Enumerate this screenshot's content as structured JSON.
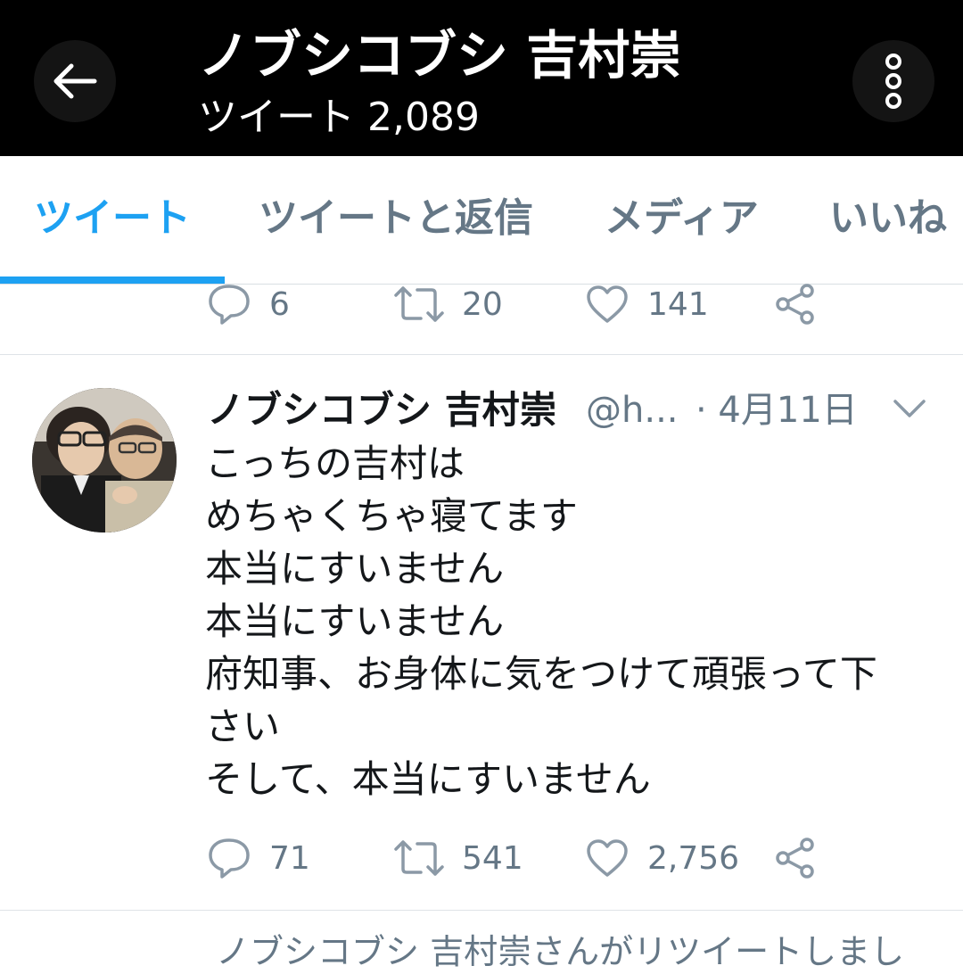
{
  "header": {
    "title": "ノブシコブシ 吉村崇",
    "subtitle": "ツイート 2,089"
  },
  "tabs": [
    {
      "label": "ツイート",
      "active": true
    },
    {
      "label": "ツイートと返信",
      "active": false
    },
    {
      "label": "メディア",
      "active": false
    },
    {
      "label": "いいね",
      "active": false
    }
  ],
  "prev_tweet": {
    "replies": "6",
    "retweets": "20",
    "likes": "141"
  },
  "tweet": {
    "author": "ノブシコブシ 吉村崇",
    "handle": "@h...",
    "date": "· 4月11日",
    "lines": [
      "こっちの吉村は",
      "めちゃくちゃ寝てます",
      "本当にすいません",
      "本当にすいません",
      "府知事、お身体に気をつけて頑張って下",
      "さい",
      "そして、本当にすいません"
    ],
    "replies": "71",
    "retweets": "541",
    "likes": "2,756"
  },
  "next_tweet": {
    "retweet_note": "ノブシコブシ 吉村崇さんがリツイートしまし"
  },
  "colors": {
    "accent": "#1da1f2",
    "muted": "#657786",
    "header_bg": "#000000"
  }
}
